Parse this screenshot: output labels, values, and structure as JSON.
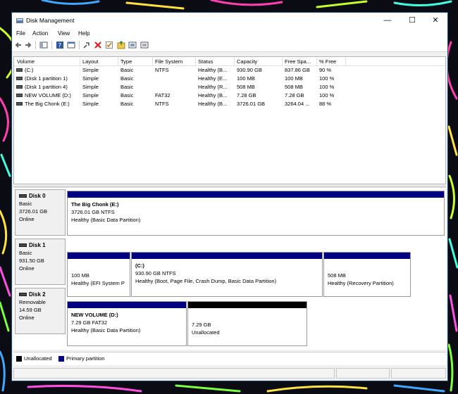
{
  "window": {
    "title": "Disk Management"
  },
  "menu": [
    {
      "label": "File"
    },
    {
      "label": "Action"
    },
    {
      "label": "View"
    },
    {
      "label": "Help"
    }
  ],
  "toolbar": {
    "icons": [
      "back-arrow-icon",
      "forward-arrow-icon",
      "console-tree-icon",
      "help-icon",
      "properties-icon",
      "connect-icon",
      "delete-icon",
      "check-icon",
      "refresh-icon",
      "rescan-icon",
      "settings-icon"
    ]
  },
  "volume_list": {
    "columns": [
      "Volume",
      "Layout",
      "Type",
      "File System",
      "Status",
      "Capacity",
      "Free Spa...",
      "% Free"
    ],
    "rows": [
      {
        "volume": "(C:)",
        "layout": "Simple",
        "type": "Basic",
        "fs": "NTFS",
        "status": "Healthy (B...",
        "capacity": "930.90 GB",
        "free": "837.86 GB",
        "pct": "90 %"
      },
      {
        "volume": "(Disk 1 partition 1)",
        "layout": "Simple",
        "type": "Basic",
        "fs": "",
        "status": "Healthy (E...",
        "capacity": "100 MB",
        "free": "100 MB",
        "pct": "100 %"
      },
      {
        "volume": "(Disk 1 partition 4)",
        "layout": "Simple",
        "type": "Basic",
        "fs": "",
        "status": "Healthy (R...",
        "capacity": "508 MB",
        "free": "508 MB",
        "pct": "100 %"
      },
      {
        "volume": "NEW VOLUME (D:)",
        "layout": "Simple",
        "type": "Basic",
        "fs": "FAT32",
        "status": "Healthy (B...",
        "capacity": "7.28 GB",
        "free": "7.28 GB",
        "pct": "100 %"
      },
      {
        "volume": "The Big Chonk (E:)",
        "layout": "Simple",
        "type": "Basic",
        "fs": "NTFS",
        "status": "Healthy (B...",
        "capacity": "3726.01 GB",
        "free": "3264.04 ...",
        "pct": "88 %"
      }
    ]
  },
  "disks": [
    {
      "name": "Disk 0",
      "type": "Basic",
      "size": "3726.01 GB",
      "state": "Online",
      "partitions": [
        {
          "title": "The Big Chonk  (E:)",
          "line1": "3726.01 GB NTFS",
          "line2": "Healthy (Basic Data Partition)",
          "kind": "primary"
        }
      ]
    },
    {
      "name": "Disk 1",
      "type": "Basic",
      "size": "931.50 GB",
      "state": "Online",
      "partitions": [
        {
          "title": "",
          "line1": "100 MB",
          "line2": "Healthy (EFI System P",
          "kind": "primary"
        },
        {
          "title": "(C:)",
          "line1": "930.90 GB NTFS",
          "line2": "Healthy (Boot, Page File, Crash Dump, Basic Data Partition)",
          "kind": "primary"
        },
        {
          "title": "",
          "line1": "508 MB",
          "line2": "Healthy (Recovery Partition)",
          "kind": "primary"
        }
      ]
    },
    {
      "name": "Disk 2",
      "type": "Removable",
      "size": "14.59 GB",
      "state": "Online",
      "partitions": [
        {
          "title": "NEW VOLUME  (D:)",
          "line1": "7.29 GB FAT32",
          "line2": "Healthy (Basic Data Partition)",
          "kind": "primary"
        },
        {
          "title": "",
          "line1": "7.29 GB",
          "line2": "Unallocated",
          "kind": "unallocated"
        }
      ]
    }
  ],
  "legend": [
    {
      "label": "Unallocated",
      "color": "#000000"
    },
    {
      "label": "Primary partition",
      "color": "#000080"
    }
  ]
}
